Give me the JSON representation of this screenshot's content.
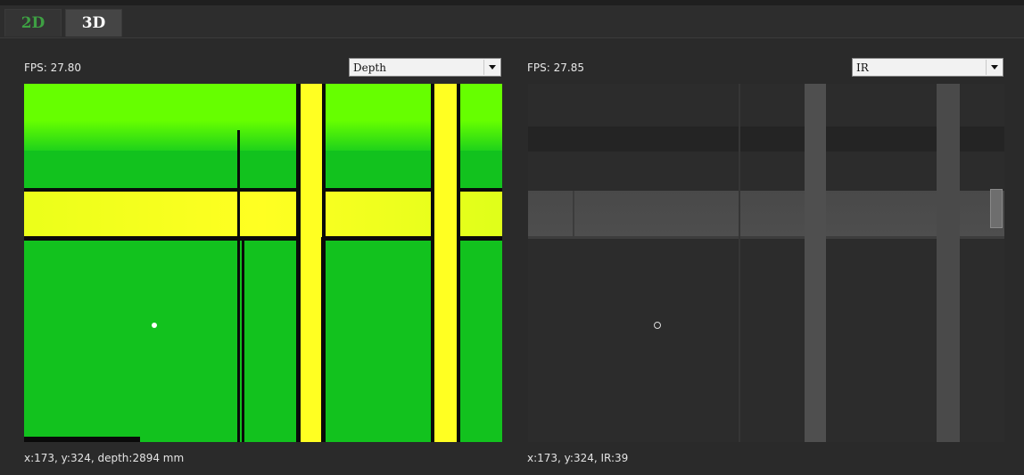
{
  "tabs": [
    {
      "label": "2D",
      "active": true
    },
    {
      "label": "3D",
      "active": false
    }
  ],
  "left_panel": {
    "fps_text": "FPS: 27.80",
    "mode_selected": "Depth",
    "cursor_readout": "x:173, y:324, depth:2894 mm"
  },
  "right_panel": {
    "fps_text": "FPS: 27.85",
    "mode_selected": "IR",
    "cursor_readout": "x:173, y:324, IR:39"
  },
  "colors": {
    "active_tab_text": "#3ea043",
    "depth_near": "#ffff1a",
    "depth_mid": "#12c21e",
    "depth_far": "#66ff00"
  }
}
